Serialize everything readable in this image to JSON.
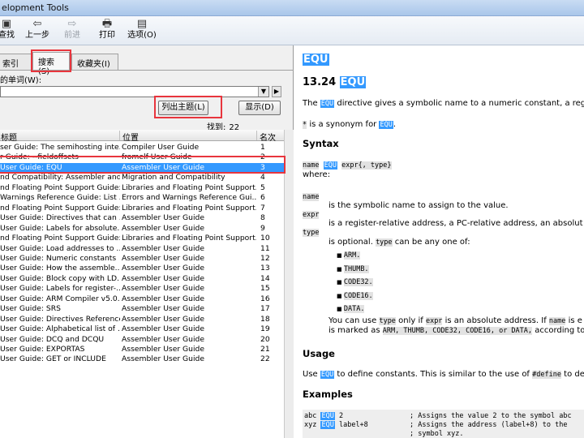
{
  "window": {
    "title": "elopment Tools"
  },
  "toolbar": {
    "find": {
      "icon": "find-icon",
      "label": "查找"
    },
    "back": {
      "icon": "back-arrow-icon",
      "label": "上一步"
    },
    "forward": {
      "icon": "forward-arrow-icon",
      "label": "前进"
    },
    "print": {
      "icon": "printer-icon",
      "label": "打印"
    },
    "options": {
      "icon": "options-icon",
      "label": "选项(O)"
    }
  },
  "tabs": {
    "index": "索引",
    "search": "搜索(S)",
    "favorites": "收藏夹(I)"
  },
  "search_panel": {
    "keyword_label": "的单词(W):",
    "keyword_value": "",
    "list_topics_button": "列出主题(L)",
    "display_button": "显示(D)",
    "found_label": "找到:",
    "found_count": "22"
  },
  "results": {
    "headers": {
      "title": "标题",
      "location": "位置",
      "rank": "名次"
    },
    "rows": [
      {
        "title": "ser Guide: The semihosting inte...",
        "location": "Compiler User Guide",
        "rank": "1"
      },
      {
        "title": "r Guide: --fieldoffsets",
        "location": "fromelf User Guide",
        "rank": "2"
      },
      {
        "title": "User Guide: EQU",
        "location": "Assembler User Guide",
        "rank": "3"
      },
      {
        "title": "nd Compatibility: Assembler and ...",
        "location": "Migration and Compatibility",
        "rank": "4"
      },
      {
        "title": "nd Floating Point Support Guide: ...",
        "location": "Libraries and Floating Point Support...",
        "rank": "5"
      },
      {
        "title": "Warnings Reference Guide: List ...",
        "location": "Errors and Warnings Reference Gui...",
        "rank": "6"
      },
      {
        "title": "nd Floating Point Support Guide: ...",
        "location": "Libraries and Floating Point Support...",
        "rank": "7"
      },
      {
        "title": "User Guide: Directives that can ...",
        "location": "Assembler User Guide",
        "rank": "8"
      },
      {
        "title": "User Guide: Labels for absolute...",
        "location": "Assembler User Guide",
        "rank": "9"
      },
      {
        "title": "nd Floating Point Support Guide: ...",
        "location": "Libraries and Floating Point Support...",
        "rank": "10"
      },
      {
        "title": "User Guide: Load addresses to ...",
        "location": "Assembler User Guide",
        "rank": "11"
      },
      {
        "title": "User Guide: Numeric constants",
        "location": "Assembler User Guide",
        "rank": "12"
      },
      {
        "title": "User Guide: How the assemble...",
        "location": "Assembler User Guide",
        "rank": "13"
      },
      {
        "title": "User Guide: Block copy with LD...",
        "location": "Assembler User Guide",
        "rank": "14"
      },
      {
        "title": "User Guide: Labels for register-...",
        "location": "Assembler User Guide",
        "rank": "15"
      },
      {
        "title": "User Guide: ARM Compiler v5.0...",
        "location": "Assembler User Guide",
        "rank": "16"
      },
      {
        "title": "User Guide: SRS",
        "location": "Assembler User Guide",
        "rank": "17"
      },
      {
        "title": "User Guide: Directives Reference",
        "location": "Assembler User Guide",
        "rank": "18"
      },
      {
        "title": "User Guide: Alphabetical list of ...",
        "location": "Assembler User Guide",
        "rank": "19"
      },
      {
        "title": "User Guide: DCQ and DCQU",
        "location": "Assembler User Guide",
        "rank": "20"
      },
      {
        "title": "User Guide: EXPORTAS",
        "location": "Assembler User Guide",
        "rank": "21"
      },
      {
        "title": "User Guide: GET or INCLUDE",
        "location": "Assembler User Guide",
        "rank": "22"
      }
    ]
  },
  "doc": {
    "title": "EQU",
    "section_num": "13.24",
    "section_kw": "EQU",
    "intro_pre": "The",
    "intro_kw": "EQU",
    "intro_post": "directive gives a symbolic name to a numeric constant, a regis",
    "synonym_star": "*",
    "synonym_text": "is a synonym for",
    "synonym_kw": "EQU",
    "synonym_end": ".",
    "syntax_heading": "Syntax",
    "syntax_name": "name",
    "syntax_kw": "EQU",
    "syntax_rest": "expr{, type}",
    "where": "where:",
    "def_name_term": "name",
    "def_name_desc": "is the symbolic name to assign to the value.",
    "def_expr_term": "expr",
    "def_expr_desc": "is a register-relative address, a PC-relative address, an absolut",
    "def_type_term": "type",
    "def_type_desc_pre": "is optional.",
    "def_type_code": "type",
    "def_type_desc_post": "can be any one of:",
    "types": [
      "ARM.",
      "THUMB.",
      "CODE32.",
      "CODE16.",
      "DATA."
    ],
    "note1_pre": "You can use",
    "note1_code1": "type",
    "note1_mid": "only if",
    "note1_code2": "expr",
    "note1_mid2": "is an absolute address. If",
    "note1_code3": "name",
    "note1_end": "is e",
    "note2_pre": "is marked as",
    "note2_codes": "ARM, THUMB, CODE32, CODE16, or DATA,",
    "note2_post": "according to ty",
    "usage_heading": "Usage",
    "usage_pre": "Use",
    "usage_kw": "EQU",
    "usage_mid": "to define constants. This is similar to the use of",
    "usage_code": "#define",
    "usage_end": "to def",
    "examples_heading": "Examples",
    "ex1_label": "abc",
    "ex1_kw": "EQU",
    "ex1_arg": "2",
    "ex1_comment": "; Assigns the value 2 to the symbol abc",
    "ex2_label": "xyz",
    "ex2_kw": "EQU",
    "ex2_arg": "label+8",
    "ex2_comment": "; Assigns the address (label+8) to the",
    "ex3_comment": "; symbol xyz."
  },
  "colors": {
    "highlight": "#3399ff",
    "annotation_red": "#e8353d",
    "selection": "#3399ff"
  }
}
